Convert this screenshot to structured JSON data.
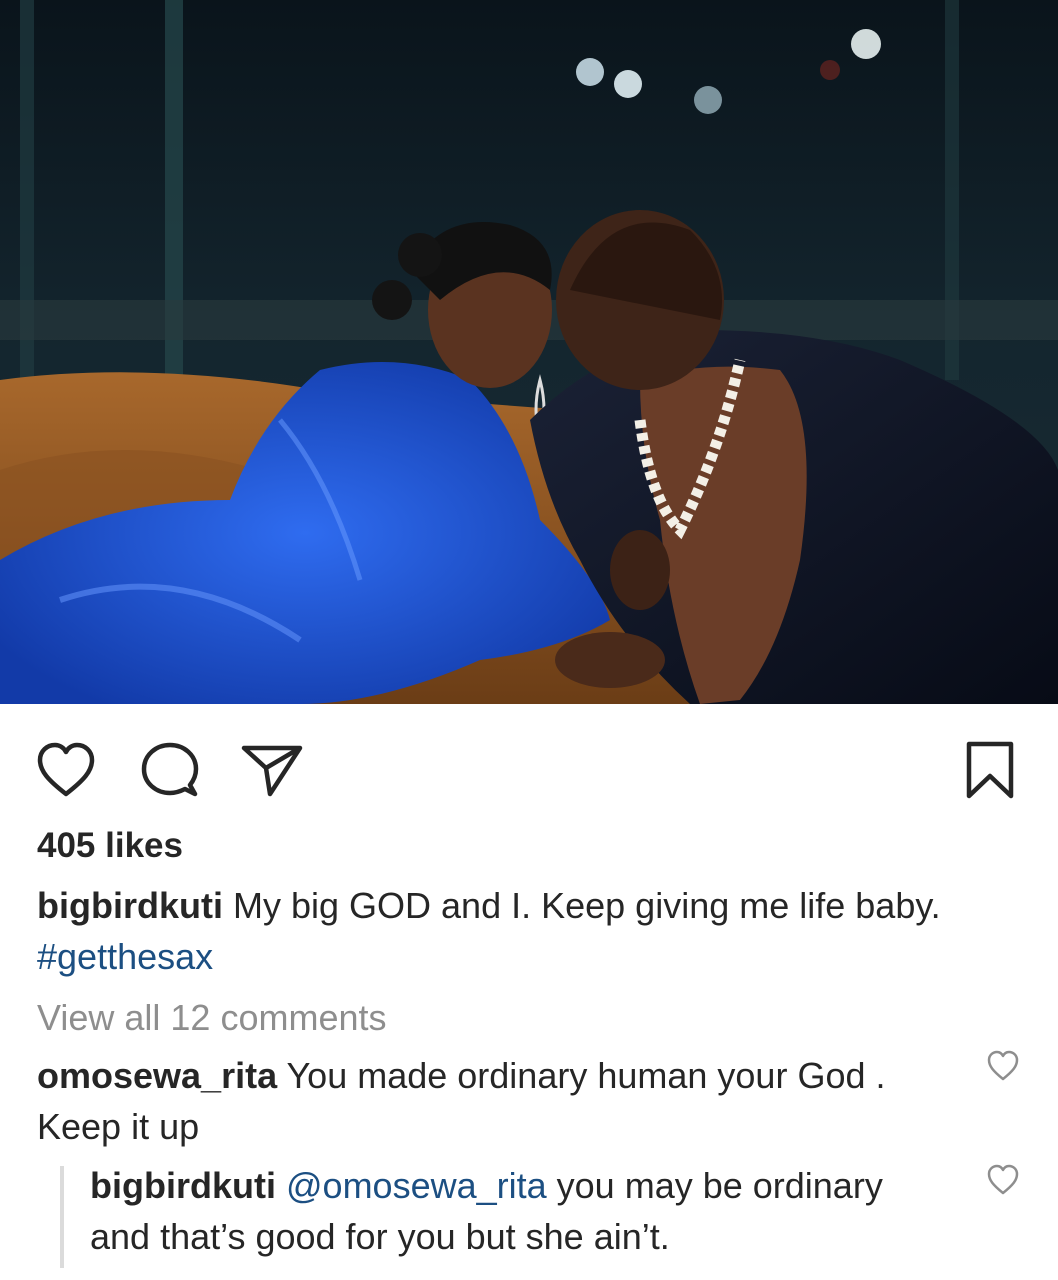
{
  "post": {
    "likes_text": "405 likes",
    "caption": {
      "username": "bigbirdkuti",
      "text": " My big GOD and I. Keep giving me life baby.",
      "hashtag": "#getthesax"
    },
    "view_all_comments": "View all 12 comments"
  },
  "comments": [
    {
      "username": "omosewa_rita",
      "text": " You made ordinary human your God . Keep it up"
    }
  ],
  "reply": {
    "username": "bigbirdkuti",
    "mention": "@omosewa_rita",
    "text": " you may be ordinary and that’s good for you but she ain’t."
  },
  "icons": {
    "like": "heart-icon",
    "comment": "comment-icon",
    "share": "paper-plane-icon",
    "save": "bookmark-icon",
    "comment_like": "small-heart-icon"
  },
  "colors": {
    "text": "#262626",
    "link": "#1c4f82",
    "muted": "#8e8e8e"
  }
}
